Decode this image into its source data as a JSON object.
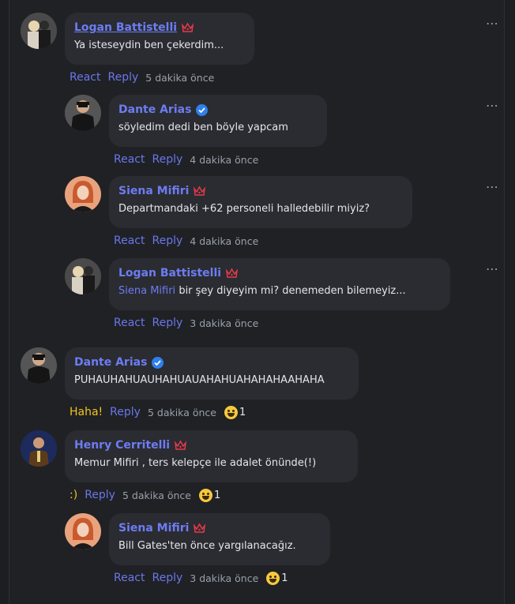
{
  "colors": {
    "accent": "#6d7cf2",
    "background": "#1f2125",
    "bubble": "#2a2c31",
    "badge_red": "#e8394b",
    "badge_blue": "#2f80ed",
    "haha": "#f3c320"
  },
  "more_icon": "⋯",
  "comments": [
    {
      "name": "Logan Battistelli",
      "badge": "crown-icon",
      "text": "Ya isteseydin ben çekerdim...",
      "actions": [
        "React",
        "Reply"
      ],
      "time": "5 dakika önce"
    },
    {
      "name": "Dante Arias",
      "badge": "verified-icon",
      "text": "söyledim dedi ben böyle yapcam",
      "actions": [
        "React",
        "Reply"
      ],
      "time": "4 dakika önce"
    },
    {
      "name": "Siena Mifiri",
      "badge": "crown-icon",
      "text": "Departmandaki +62 personeli halledebilir miyiz?",
      "actions": [
        "React",
        "Reply"
      ],
      "time": "4 dakika önce"
    },
    {
      "name": "Logan Battistelli",
      "badge": "crown-icon",
      "mention": "Siena Mifiri",
      "text": " bir şey diyeyim mi? denemeden bilemeyiz...",
      "actions": [
        "React",
        "Reply"
      ],
      "time": "3 dakika önce"
    },
    {
      "name": "Dante Arias",
      "badge": "verified-icon",
      "text": "PUHAUHAHUAUHAHUAUAHAHUAHAHAHAAHAHA",
      "actions": [
        "Haha!",
        "Reply"
      ],
      "time": "5 dakika önce",
      "reaction_count": "1"
    },
    {
      "name": "Henry Cerritelli",
      "badge": "crown-icon",
      "text": "Memur Mifiri , ters kelepçe ile adalet önünde(!)",
      "actions": [
        ":)",
        "Reply"
      ],
      "time": "5 dakika önce",
      "reaction_count": "1"
    },
    {
      "name": "Siena Mifiri",
      "badge": "crown-icon",
      "text": "Bill Gates'ten önce yargılanacağız.",
      "actions": [
        "React",
        "Reply"
      ],
      "time": "3 dakika önce",
      "reaction_count": "1"
    }
  ]
}
